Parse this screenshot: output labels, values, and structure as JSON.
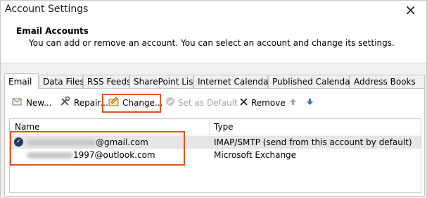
{
  "window": {
    "title": "Account Settings",
    "close_glyph": "×"
  },
  "header": {
    "title": "Email Accounts",
    "description": "You can add or remove an account. You can select an account and change its settings."
  },
  "tabs": [
    {
      "label": "Email",
      "active": true
    },
    {
      "label": "Data Files"
    },
    {
      "label": "RSS Feeds"
    },
    {
      "label": "SharePoint Lists"
    },
    {
      "label": "Internet Calendars"
    },
    {
      "label": "Published Calendars"
    },
    {
      "label": "Address Books"
    }
  ],
  "toolbar": {
    "new_label": "New...",
    "repair_label": "Repair...",
    "change_label": "Change...",
    "set_default_label": "Set as Default",
    "remove_label": "Remove"
  },
  "grid": {
    "columns": [
      "Name",
      "Type"
    ],
    "rows": [
      {
        "name_visible": "@gmail.com",
        "type": "IMAP/SMTP (send from this account by default)",
        "default": true
      },
      {
        "name_visible": "1997@outlook.com",
        "type": "Microsoft Exchange",
        "default": false
      }
    ]
  },
  "colors": {
    "highlight": "#e8521f",
    "panel_bg": "#f0f0f0",
    "selected_row": "#e6e6e6",
    "arrow_up": "#9aa5b1",
    "arrow_down": "#2f6fd6"
  }
}
